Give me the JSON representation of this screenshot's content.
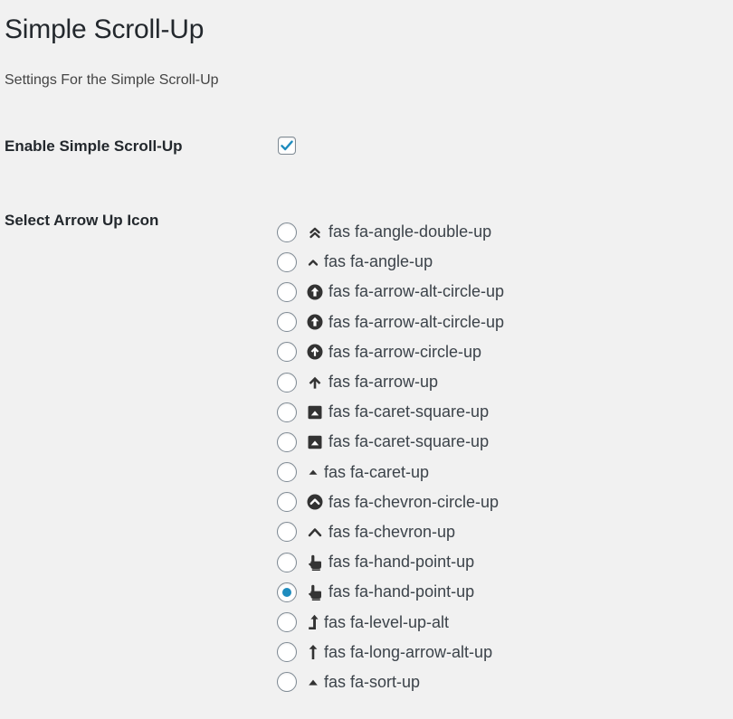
{
  "header": {
    "title": "Simple Scroll-Up",
    "subtitle": "Settings For the Simple Scroll-Up"
  },
  "settings": {
    "enable_label": "Enable Simple Scroll-Up",
    "enable_checked": true,
    "icon_label": "Select Arrow Up Icon"
  },
  "icon_options": [
    {
      "label": "fas fa-angle-double-up",
      "icon": "angle-double-up-icon",
      "checked": false
    },
    {
      "label": "fas fa-angle-up",
      "icon": "angle-up-icon",
      "checked": false
    },
    {
      "label": "fas fa-arrow-alt-circle-up",
      "icon": "arrow-alt-circle-up-icon",
      "checked": false
    },
    {
      "label": "fas fa-arrow-alt-circle-up",
      "icon": "arrow-alt-circle-up-icon",
      "checked": false
    },
    {
      "label": "fas fa-arrow-circle-up",
      "icon": "arrow-circle-up-icon",
      "checked": false
    },
    {
      "label": "fas fa-arrow-up",
      "icon": "arrow-up-icon",
      "checked": false
    },
    {
      "label": "fas fa-caret-square-up",
      "icon": "caret-square-up-icon",
      "checked": false
    },
    {
      "label": "fas fa-caret-square-up",
      "icon": "caret-square-up-icon",
      "checked": false
    },
    {
      "label": "fas fa-caret-up",
      "icon": "caret-up-icon",
      "checked": false
    },
    {
      "label": "fas fa-chevron-circle-up",
      "icon": "chevron-circle-up-icon",
      "checked": false
    },
    {
      "label": "fas fa-chevron-up",
      "icon": "chevron-up-icon",
      "checked": false
    },
    {
      "label": "fas fa-hand-point-up",
      "icon": "hand-point-up-icon",
      "checked": false
    },
    {
      "label": "fas fa-hand-point-up",
      "icon": "hand-point-up-icon",
      "checked": true
    },
    {
      "label": "fas fa-level-up-alt",
      "icon": "level-up-alt-icon",
      "checked": false
    },
    {
      "label": "fas fa-long-arrow-alt-up",
      "icon": "long-arrow-alt-up-icon",
      "checked": false
    },
    {
      "label": "fas fa-sort-up",
      "icon": "sort-up-icon",
      "checked": false
    }
  ],
  "colors": {
    "background": "#f1f1f1",
    "accent": "#1e8cbe",
    "text": "#23282d",
    "icon": "#333333"
  }
}
